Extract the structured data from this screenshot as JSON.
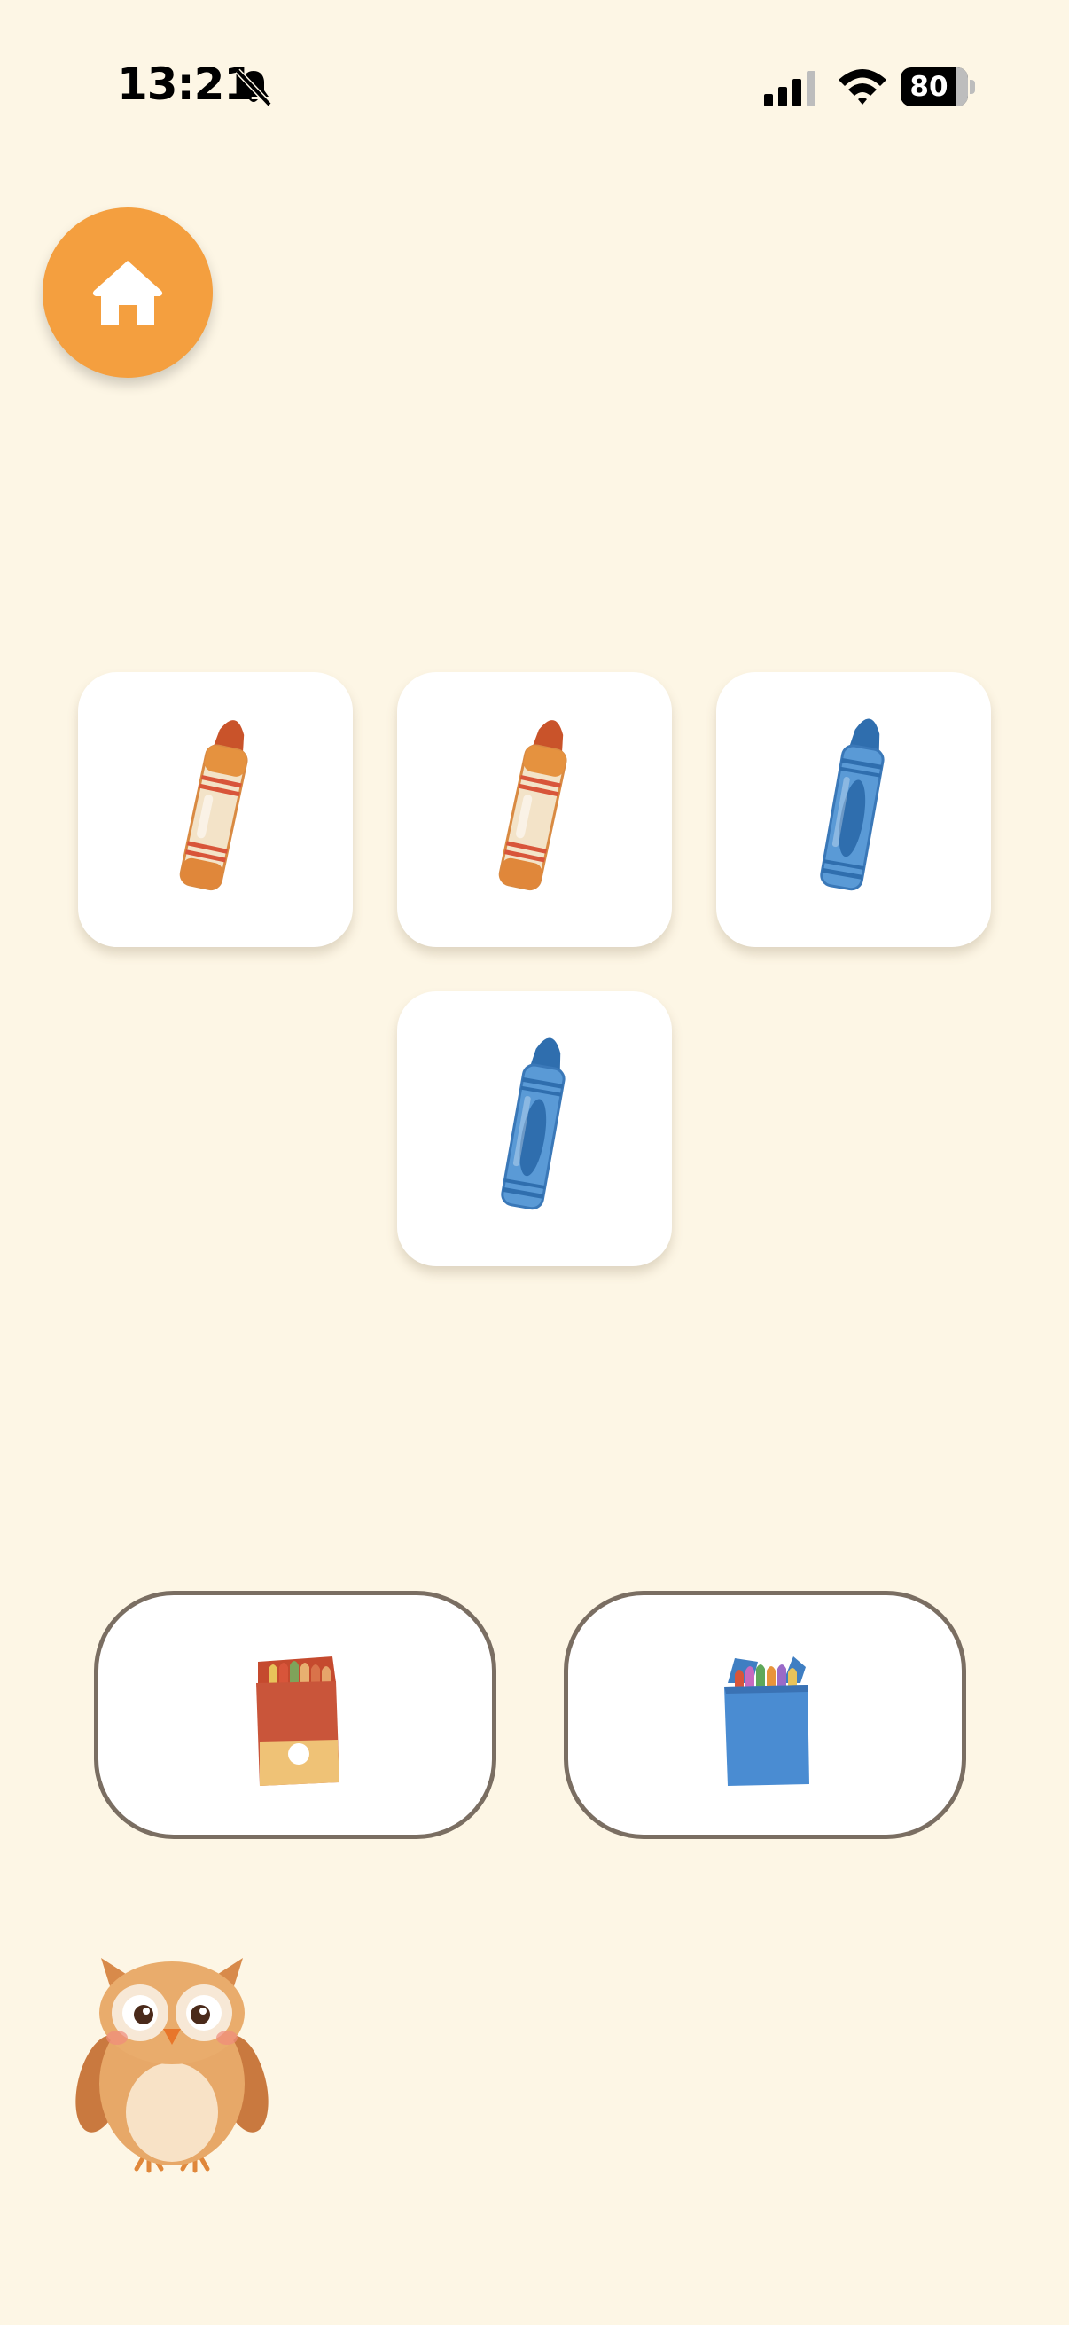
{
  "status_bar": {
    "time": "13:21",
    "battery_level": "80",
    "icons": [
      "bell-off-icon",
      "cellular-signal-icon",
      "wifi-icon",
      "battery-icon"
    ]
  },
  "home_button": {
    "icon": "home-icon",
    "color": "#F49F3F"
  },
  "crayons": [
    {
      "color": "orange",
      "icon": "orange-crayon-icon"
    },
    {
      "color": "orange",
      "icon": "orange-crayon-icon"
    },
    {
      "color": "blue",
      "icon": "blue-crayon-icon"
    },
    {
      "color": "blue",
      "icon": "blue-crayon-icon"
    }
  ],
  "sort_boxes": [
    {
      "color": "orange",
      "icon": "orange-crayon-box-icon"
    },
    {
      "color": "blue",
      "icon": "blue-crayon-box-icon"
    }
  ],
  "mascot": {
    "icon": "owl-mascot-icon"
  },
  "colors": {
    "background": "#FDF6E5",
    "accent": "#F49F3F",
    "orange_crayon": "#E8944A",
    "blue_crayon": "#4A8CCB",
    "box_border": "#7A6E62"
  }
}
